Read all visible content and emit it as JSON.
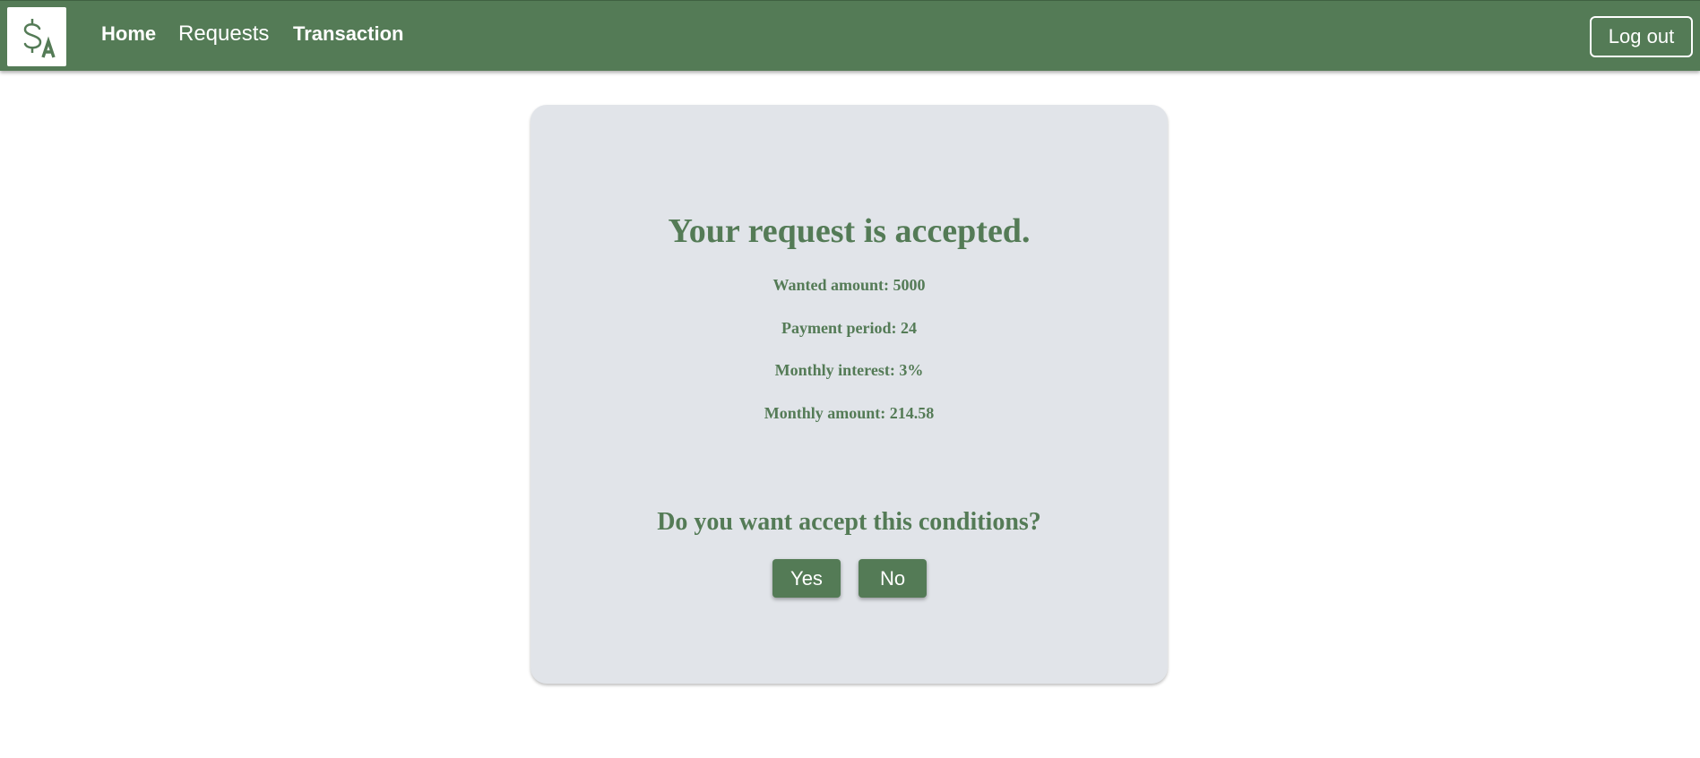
{
  "brand": {
    "logo_icon": "dollar-sign-a-logo",
    "logo_color": "#547b56"
  },
  "nav": {
    "home_label": "Home",
    "requests_label": "Requests",
    "transaction_label": "Transaction",
    "logout_label": "Log out",
    "background_color": "#547b56"
  },
  "result": {
    "title": "Your request is accepted.",
    "wanted_amount": "Wanted amount: 5000",
    "payment_period": "Payment period: 24",
    "monthly_interest": "Monthly interest: 3%",
    "monthly_amount": "Monthly amount: 214.58",
    "question": "Do you want accept this conditions?",
    "yes_label": "Yes",
    "no_label": "No"
  },
  "colors": {
    "accent": "#547b56",
    "card_background": "#e1e4e9",
    "text_on_accent": "#ffffff"
  }
}
